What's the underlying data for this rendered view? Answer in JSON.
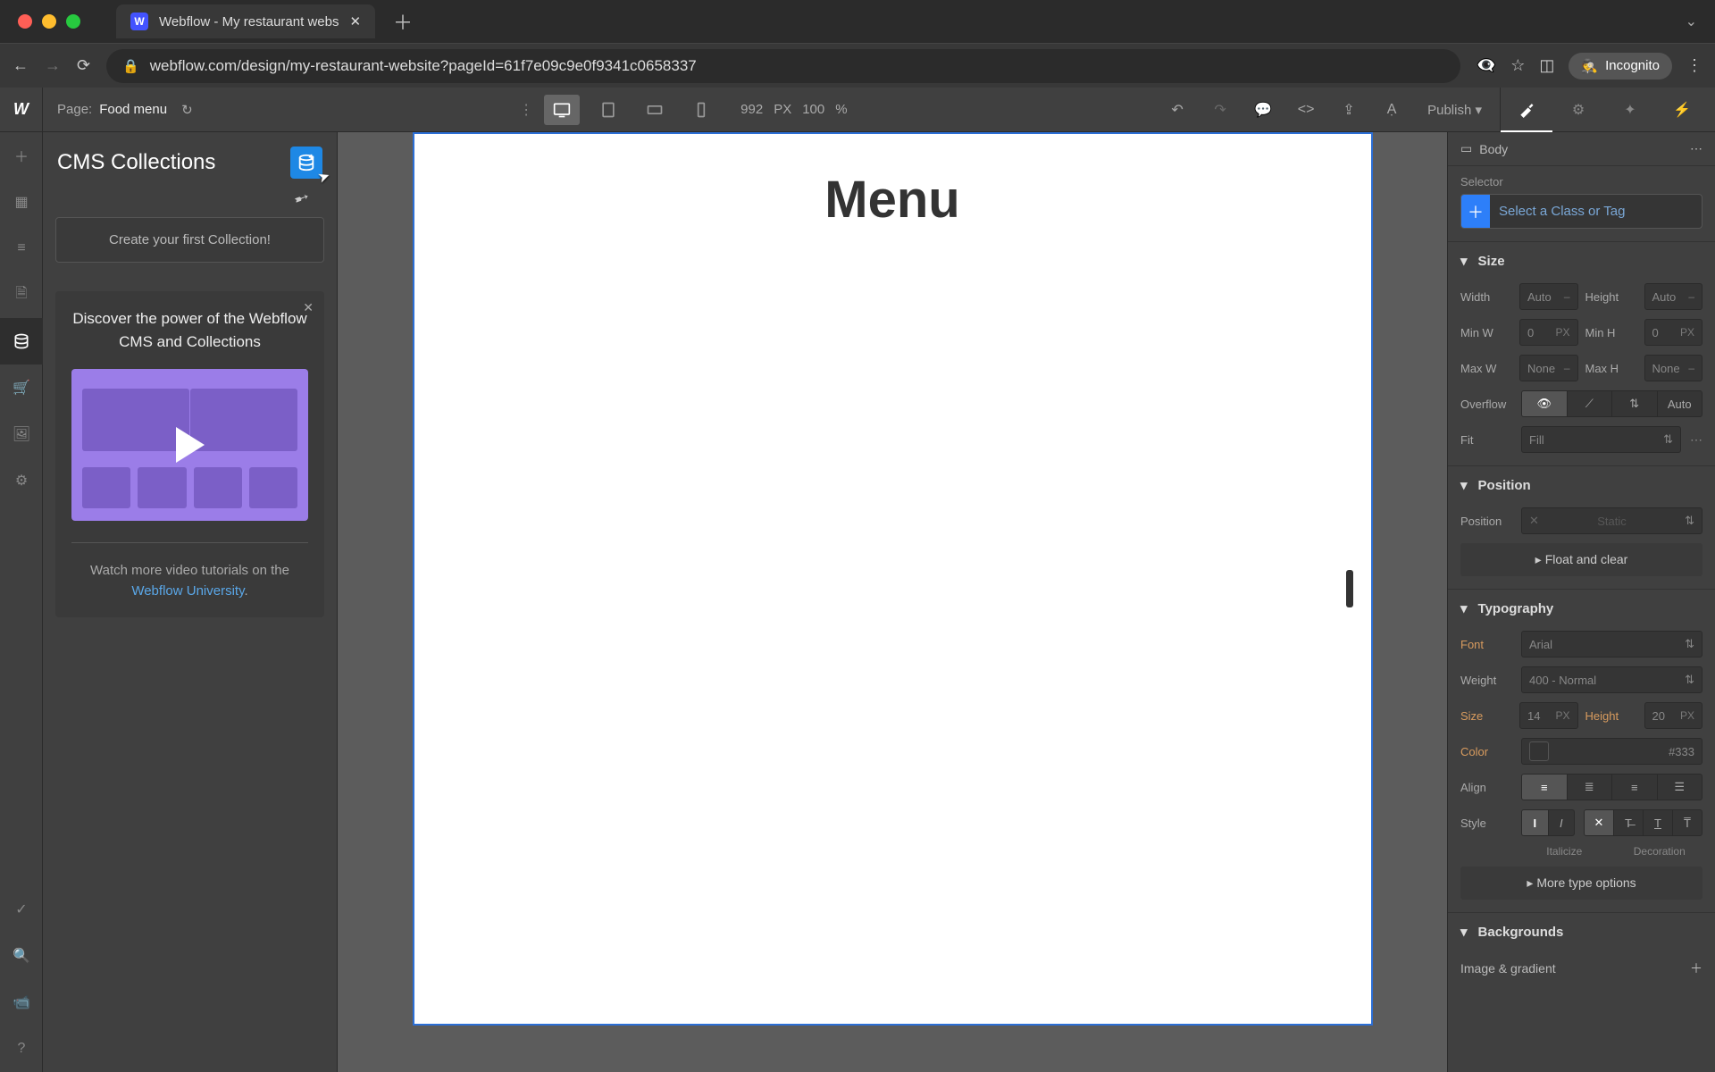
{
  "browser": {
    "tab_title": "Webflow - My restaurant webs",
    "url": "webflow.com/design/my-restaurant-website?pageId=61f7e09c9e0f9341c0658337",
    "incognito_label": "Incognito"
  },
  "topbar": {
    "page_label": "Page:",
    "page_name": "Food menu",
    "canvas_width": "992",
    "width_unit": "PX",
    "zoom": "100",
    "zoom_unit": "%",
    "publish_label": "Publish"
  },
  "left": {
    "title": "CMS Collections",
    "first_collection": "Create your first Collection!",
    "promo_title": "Discover the power of the Webflow CMS and Collections",
    "promo_sub_pre": "Watch more video tutorials on the ",
    "promo_link": "Webflow University",
    "promo_sub_post": "."
  },
  "canvas": {
    "heading": "Menu"
  },
  "right": {
    "breadcrumb": "Body",
    "selector_label": "Selector",
    "selector_placeholder": "Select a Class or Tag",
    "size": {
      "title": "Size",
      "width_label": "Width",
      "width_val": "Auto",
      "height_label": "Height",
      "height_val": "Auto",
      "minw_label": "Min W",
      "minw_val": "0",
      "minw_unit": "PX",
      "minh_label": "Min H",
      "minh_val": "0",
      "minh_unit": "PX",
      "maxw_label": "Max W",
      "maxw_val": "None",
      "maxh_label": "Max H",
      "maxh_val": "None",
      "overflow_label": "Overflow",
      "overflow_auto": "Auto",
      "fit_label": "Fit",
      "fit_val": "Fill"
    },
    "position": {
      "title": "Position",
      "label": "Position",
      "val": "Static",
      "float_label": "Float and clear"
    },
    "typo": {
      "title": "Typography",
      "font_label": "Font",
      "font_val": "Arial",
      "weight_label": "Weight",
      "weight_val": "400 - Normal",
      "size_label": "Size",
      "size_val": "14",
      "size_unit": "PX",
      "lh_label": "Height",
      "lh_val": "20",
      "lh_unit": "PX",
      "color_label": "Color",
      "color_val": "#333",
      "align_label": "Align",
      "style_label": "Style",
      "italicize": "Italicize",
      "decoration": "Decoration",
      "more": "More type options"
    },
    "bg": {
      "title": "Backgrounds",
      "img_label": "Image & gradient"
    }
  }
}
